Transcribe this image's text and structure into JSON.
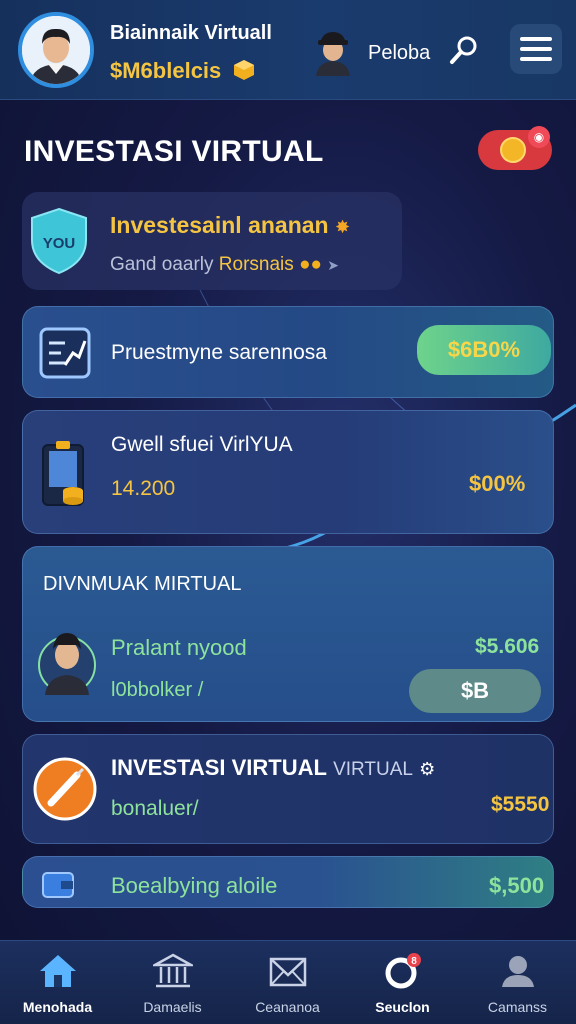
{
  "header": {
    "user_name": "Biainnaik Virtuall",
    "balance": "$M6blelcis",
    "user_label": "Peloba"
  },
  "page": {
    "title": "INVESTASI VIRTUAL"
  },
  "info_card": {
    "shield_text": "YOU",
    "title": "Investesainl ananan",
    "subtitle_prefix": "Gand oaarly",
    "subtitle_highlight": "Rorsnais"
  },
  "cards": [
    {
      "label": "Pruestmyne sarennosa",
      "value": "$6B0%"
    },
    {
      "label": "Gwell sfuei VirlYUA",
      "amount": "14.200",
      "value": "$00%"
    },
    {
      "heading": "DIVNMUAK MIRTUAL",
      "label": "Pralant nyood",
      "sublabel": "l0bbolker /",
      "value": "$5.606",
      "button": "$B"
    },
    {
      "label_bold": "INVESTASI VIRTUAL",
      "label_light": "VIRTUAL",
      "sublabel": "bonaluer/",
      "value": "$5550"
    },
    {
      "label": "Boealbying aloile",
      "value": "$,500"
    }
  ],
  "nav": [
    {
      "label": "Menohada",
      "icon": "home-icon",
      "active": true
    },
    {
      "label": "Damaelis",
      "icon": "bank-icon",
      "active": false
    },
    {
      "label": "Ceananoa",
      "icon": "mail-icon",
      "active": false
    },
    {
      "label": "Seuclon",
      "icon": "notification-icon",
      "active": false,
      "badge": "8"
    },
    {
      "label": "Camanss",
      "icon": "profile-icon",
      "active": false
    }
  ],
  "colors": {
    "accent_gold": "#f5c542",
    "accent_green": "#7fe29a",
    "accent_blue": "#2f8ee0",
    "alert_red": "#d8393f"
  }
}
